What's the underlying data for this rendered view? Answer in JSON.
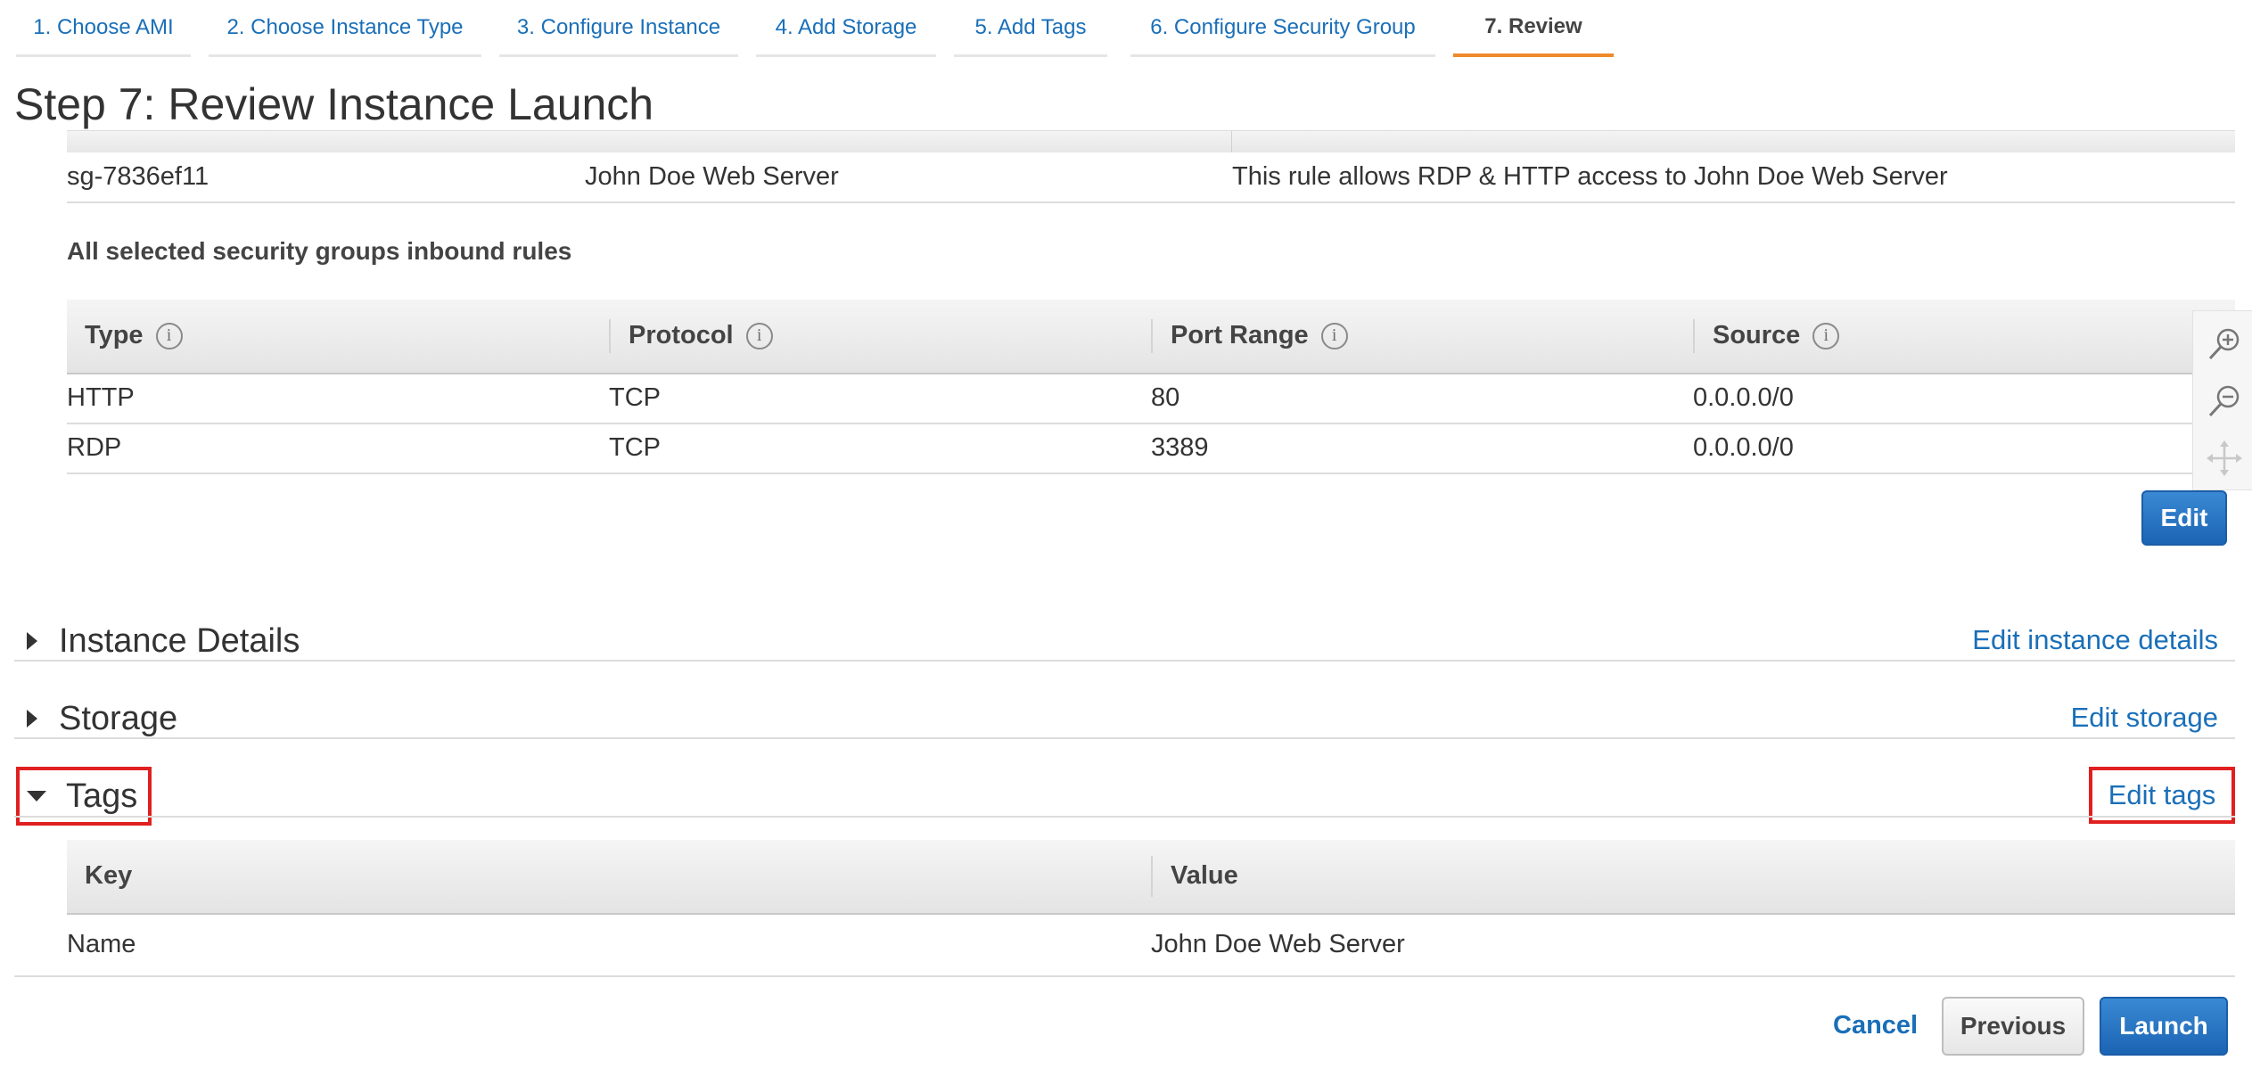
{
  "wizard": {
    "tabs": [
      {
        "label": "1. Choose AMI"
      },
      {
        "label": "2. Choose Instance Type"
      },
      {
        "label": "3. Configure Instance"
      },
      {
        "label": "4. Add Storage"
      },
      {
        "label": "5. Add Tags"
      },
      {
        "label": "6. Configure Security Group"
      },
      {
        "label": "7. Review"
      }
    ],
    "active_tab": "7. Review"
  },
  "page_title": "Step 7: Review Instance Launch",
  "security_group": {
    "id": "sg-7836ef11",
    "name": "John Doe Web Server",
    "description": "This rule allows RDP & HTTP access to John Doe Web Server"
  },
  "inbound": {
    "label": "All selected security groups inbound rules",
    "headers": [
      "Type",
      "Protocol",
      "Port Range",
      "Source"
    ],
    "info_icon": "i",
    "rows": [
      [
        "HTTP",
        "TCP",
        "80",
        "0.0.0.0/0"
      ],
      [
        "RDP",
        "TCP",
        "3389",
        "0.0.0.0/0"
      ]
    ],
    "edit_label": "Edit"
  },
  "sections": {
    "instance_details": {
      "title": "Instance Details",
      "link": "Edit instance details",
      "expanded": false
    },
    "storage": {
      "title": "Storage",
      "link": "Edit storage",
      "expanded": false
    },
    "tags": {
      "title": "Tags",
      "link": "Edit tags",
      "expanded": true
    }
  },
  "tags_table": {
    "headers": [
      "Key",
      "Value"
    ],
    "rows": [
      [
        "Name",
        "John Doe Web Server"
      ]
    ]
  },
  "footer": {
    "cancel": "Cancel",
    "previous": "Previous",
    "launch": "Launch"
  },
  "zoom_controls": [
    "zoom-in-icon",
    "zoom-out-icon",
    "pan-icon"
  ],
  "colors": {
    "link": "#1a6fb8",
    "active_tab_underline": "#f0892b",
    "primary_button": "#1b64b4",
    "highlight_box": "#e02020"
  }
}
